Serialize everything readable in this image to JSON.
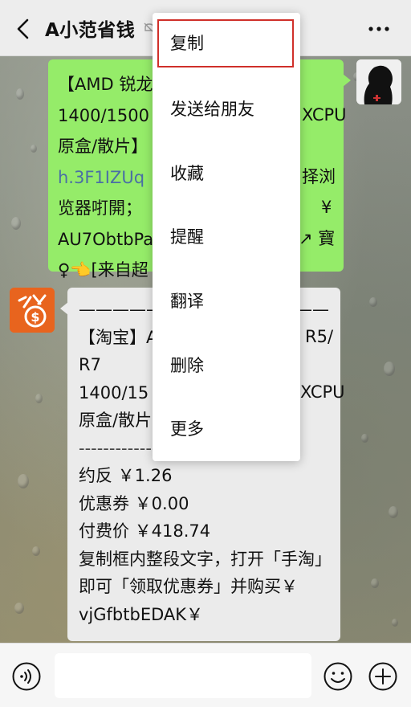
{
  "header": {
    "title": "A小范省钱",
    "back_icon": "chevron-left-icon",
    "mute_icon": "mute-icon",
    "more_icon": "more-dots-icon"
  },
  "green_message": {
    "lines": [
      "【AMD 锐龙",
      "1400/1500",
      "原盒/散片】",
      "h.3F1IZUq",
      "览器咑開；",
      "AU7ObtbPa",
      "♀👈[来自超"
    ],
    "right_lines": [
      "XCPU",
      "择浏",
      "¥",
      "↗ 寶"
    ]
  },
  "white_message": {
    "lines": [
      "——————",
      "【淘宝】A",
      "R7",
      "1400/15",
      "原盒/散片",
      "--------------------------------",
      "约反    ￥1.26",
      "优惠券 ￥0.00",
      "付费价 ￥418.74",
      "复制框内整段文字，打开「手淘」",
      "即可「领取优惠券」并购买￥",
      "vjGfbtbEDAK￥"
    ],
    "right_fragments": [
      "R5/",
      "XCPU",
      "——"
    ]
  },
  "context_menu": {
    "items": [
      "复制",
      "发送给朋友",
      "收藏",
      "提醒",
      "翻译",
      "删除",
      "更多"
    ],
    "selected_index": 0,
    "highlight_color": "#d0302a"
  },
  "input_bar": {
    "voice_icon": "voice-icon",
    "input_value": "",
    "emoji_icon": "emoji-icon",
    "plus_icon": "plus-icon"
  },
  "colors": {
    "sent_bubble": "#95ec69",
    "received_bubble": "#ebebeb",
    "avatar_brand": "#e8641e"
  }
}
